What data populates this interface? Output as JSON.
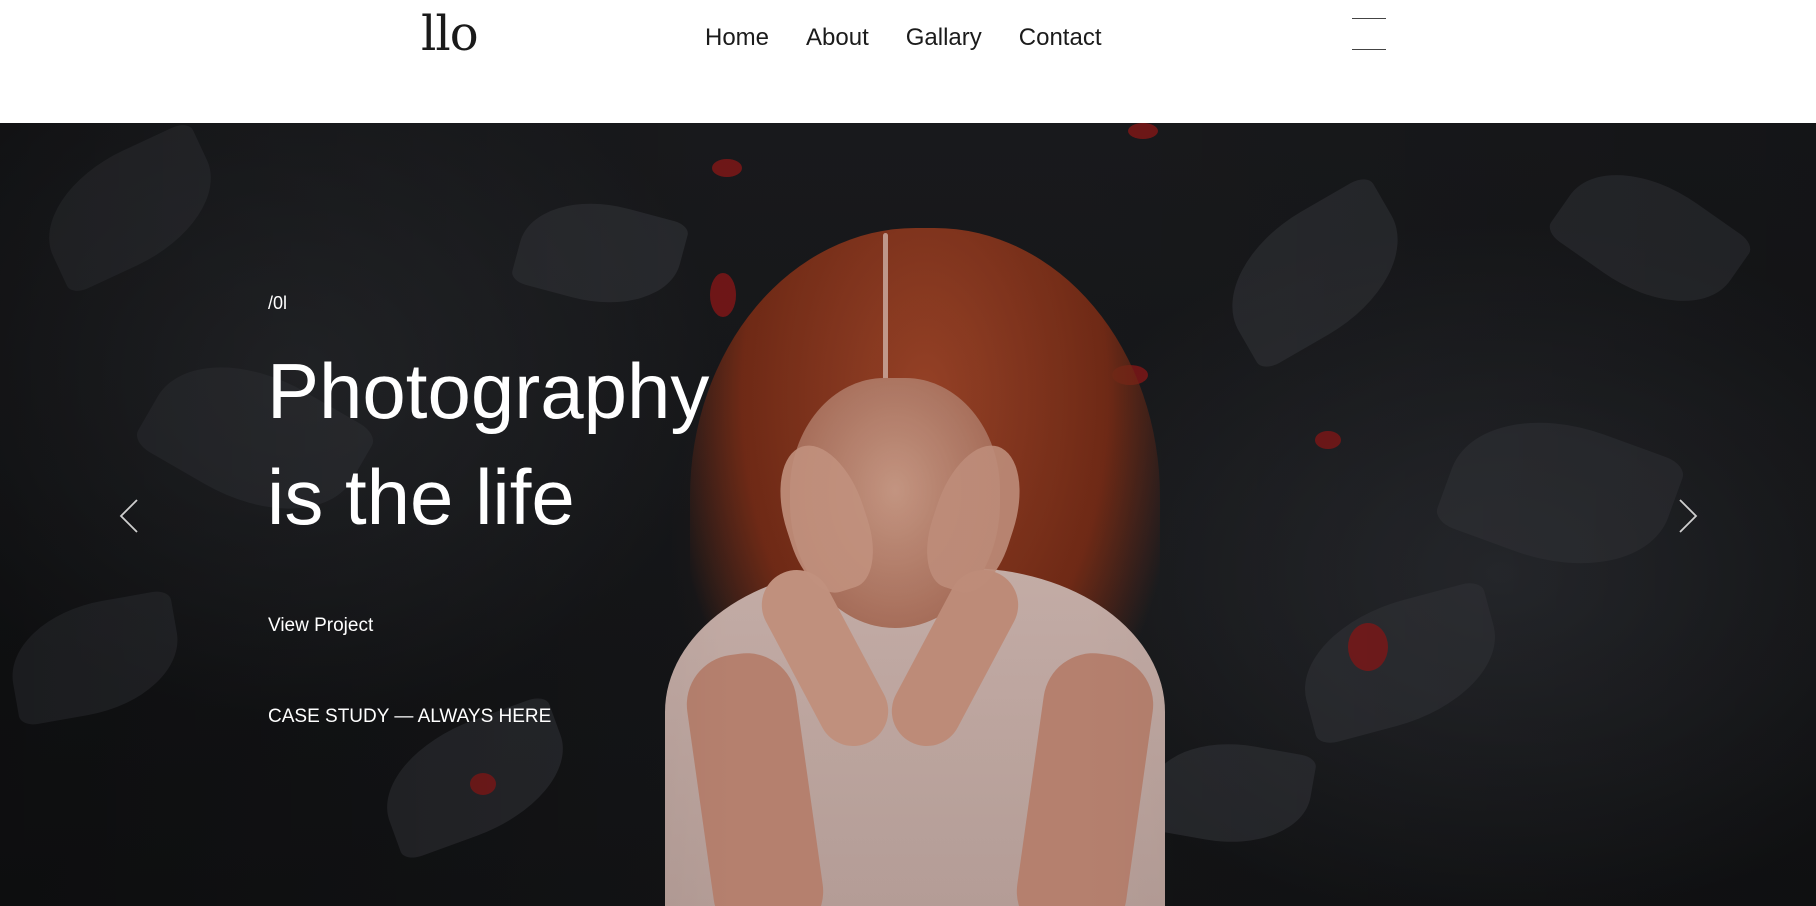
{
  "header": {
    "logo_text": "llo",
    "nav": [
      {
        "label": "Home"
      },
      {
        "label": "About"
      },
      {
        "label": "Gallary"
      },
      {
        "label": "Contact"
      }
    ],
    "menu_icon": "hamburger-icon"
  },
  "hero": {
    "slide_number": "/0l",
    "headline_line1": "Photography",
    "headline_line2": "is the life",
    "cta_label": "View Project",
    "case_study": "CASE STUDY — ALWAYS HERE",
    "prev_icon": "chevron-left-icon",
    "next_icon": "chevron-right-icon"
  },
  "colors": {
    "header_bg": "#ffffff",
    "hero_text": "#ffffff",
    "hero_bg": "#1b1c1f"
  }
}
